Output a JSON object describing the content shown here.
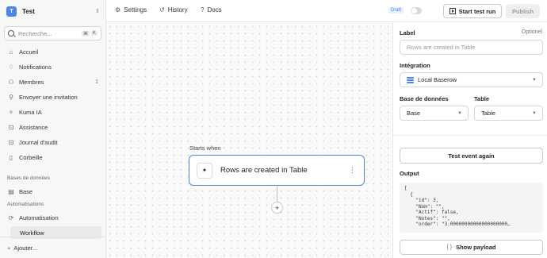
{
  "workspace": {
    "avatar": "T",
    "name": "Test"
  },
  "search": {
    "placeholder": "Recherche...",
    "kbd1": "⌘",
    "kbd2": "K"
  },
  "sidebar": {
    "items": [
      {
        "label": "Accueil",
        "icon": "home-icon"
      },
      {
        "label": "Notifications",
        "icon": "bell-icon"
      },
      {
        "label": "Membres",
        "icon": "users-icon",
        "count": "1"
      },
      {
        "label": "Envoyer une invitation",
        "icon": "user-plus-icon"
      },
      {
        "label": "Kuma IA",
        "icon": "sparkle-icon"
      },
      {
        "label": "Assistance",
        "icon": "lock-icon"
      },
      {
        "label": "Journal d'audit",
        "icon": "lock-icon"
      },
      {
        "label": "Corbeille",
        "icon": "trash-icon"
      }
    ],
    "section_db": "Bases de données",
    "db_item": "Base",
    "section_auto": "Automatisations",
    "auto_item": "Automatisation",
    "workflow_item": "Workflow",
    "add_label": "Ajouter..."
  },
  "topbar": {
    "settings": "Settings",
    "history": "History",
    "docs": "Docs",
    "draft": "Draft",
    "run": "Start test run",
    "publish": "Publish"
  },
  "canvas": {
    "starts_when": "Starts when",
    "node_label": "Rows are created in Table",
    "add": "+"
  },
  "panel": {
    "label_title": "Label",
    "optional": "Optionel",
    "label_placeholder": "Rows are created in Table",
    "integration_title": "Intégration",
    "integration_value": "Local Baserow",
    "db_title": "Base de données",
    "db_value": "Base",
    "table_title": "Table",
    "table_value": "Table",
    "test_button": "Test event again",
    "output_title": "Output",
    "output_code": "[\n  {\n    \"id\": 3,\n    \"Nom\": \"\",\n    \"Actif\": false,\n    \"Notes\": \"\",\n    \"order\": \"3.00000000000000000000…",
    "payload_button": "Show payload"
  },
  "colors": {
    "accent": "#4a86e8"
  }
}
